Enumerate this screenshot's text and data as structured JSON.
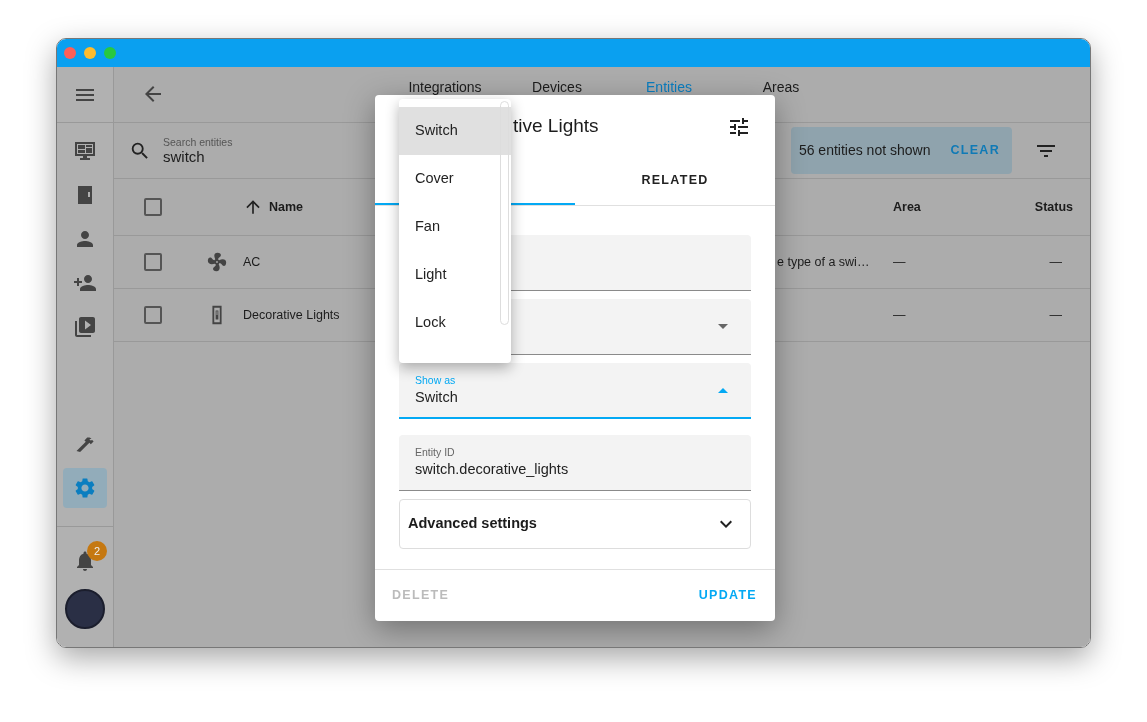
{
  "sidebar": {
    "top": [
      {
        "kind": "dashboard",
        "selected": false
      },
      {
        "kind": "panel",
        "selected": false
      },
      {
        "kind": "person",
        "selected": false
      },
      {
        "kind": "person-add",
        "selected": false
      },
      {
        "kind": "media",
        "selected": false
      }
    ],
    "bottom": [
      {
        "kind": "hammer",
        "selected": false
      },
      {
        "kind": "gear",
        "selected": true
      }
    ],
    "notifications": {
      "badge": "2"
    }
  },
  "header": {
    "tabs": [
      {
        "label": "Integrations",
        "selected": false
      },
      {
        "label": "Devices",
        "selected": false
      },
      {
        "label": "Entities",
        "selected": true
      },
      {
        "label": "Areas",
        "selected": false
      }
    ]
  },
  "search": {
    "label": "Search entities",
    "value": "switch"
  },
  "filter": {
    "text": "56 entities not shown",
    "action": "CLEAR"
  },
  "table": {
    "header_checkbox": {
      "checked": false
    },
    "columns": [
      {
        "label": "Name",
        "sorted": true
      },
      {
        "label": "Area"
      },
      {
        "label": "Status"
      }
    ],
    "rows": [
      {
        "kind": "fan",
        "name": "AC",
        "column_4": "e type of a swi…",
        "area": "—",
        "status": "—",
        "checked": false
      },
      {
        "kind": "switch",
        "name": "Decorative Lights",
        "area": "—",
        "status": "—",
        "checked": false
      }
    ]
  },
  "dialog": {
    "title": "tive Lights",
    "tabs": [
      {
        "selected": true
      },
      {
        "label": "RELATED",
        "selected": false
      }
    ],
    "fields": [
      {
        "kind": "text"
      },
      {
        "kind": "select",
        "expanded": false
      },
      {
        "kind": "select",
        "label": "Show as",
        "value": "Switch",
        "expanded": true
      },
      {
        "kind": "text",
        "label": "Entity ID",
        "value": "switch.decorative_lights"
      }
    ],
    "advanced": {
      "label": "Advanced settings",
      "expanded": false
    },
    "buttons": [
      {
        "label": "DELETE",
        "disabled": true
      },
      {
        "label": "UPDATE",
        "disabled": false
      }
    ]
  },
  "menu": {
    "items": [
      {
        "label": "Switch",
        "selected": true
      },
      {
        "label": "Cover",
        "selected": false
      },
      {
        "label": "Fan",
        "selected": false
      },
      {
        "label": "Light",
        "selected": false
      },
      {
        "label": "Lock",
        "selected": false
      }
    ]
  }
}
